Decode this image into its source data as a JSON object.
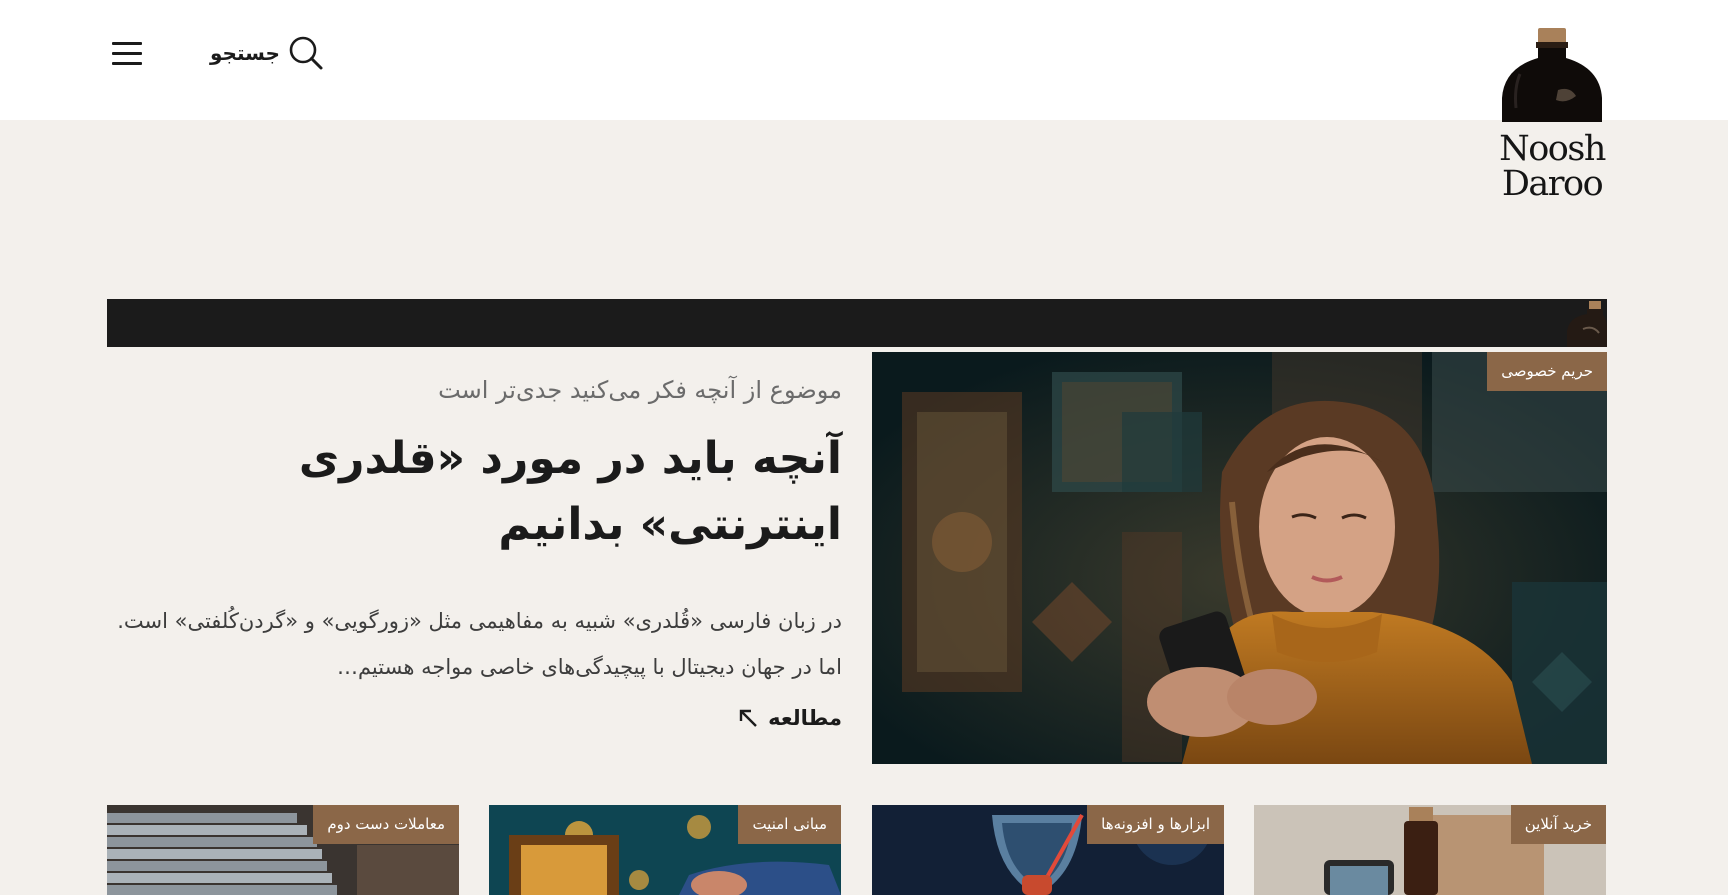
{
  "header": {
    "search_label": "جستجو",
    "logo_line1": "Noosh",
    "logo_line2": "Daroo"
  },
  "featured": {
    "category": "حریم خصوصی",
    "kicker": "موضوع از آنچه فکر می‌کنید جدی‌تر است",
    "title": "آنچه باید در مورد «قلدری اینترنتی» بدانیم",
    "excerpt": "در زبان فارسی «قُلدری» شبیه به مفاهیمی مثل «زورگویی» و «گردن‌کُلفتی» است. اما در جهان دیجیتال با پیچیدگی‌های خاصی مواجه هستیم…",
    "read_more": "مطالعه"
  },
  "cards": [
    {
      "category": "خرید آنلاین"
    },
    {
      "category": "ابزارها و افزونه‌ها"
    },
    {
      "category": "مبانی امنیت"
    },
    {
      "category": "معاملات دست دوم"
    }
  ],
  "colors": {
    "accent": "#8b6748",
    "band": "#1b1b1b",
    "page_bg": "#f3f0ec"
  },
  "icons": {
    "menu": "hamburger-icon",
    "search": "search-icon",
    "read_more": "arrow-up-left-icon"
  }
}
